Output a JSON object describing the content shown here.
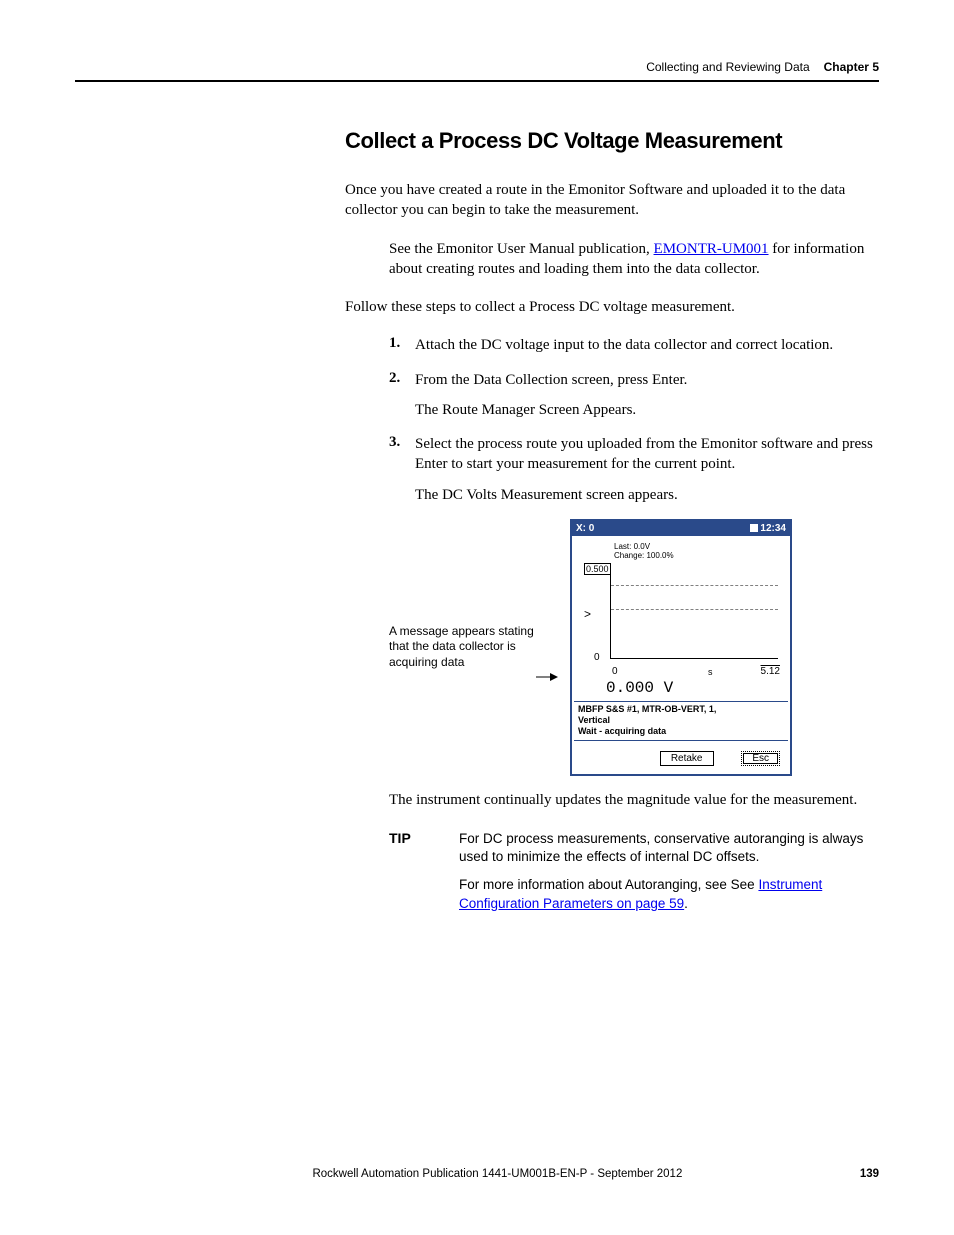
{
  "header": {
    "section": "Collecting and Reviewing Data",
    "chapter": "Chapter 5"
  },
  "title": "Collect a Process DC Voltage Measurement",
  "intro": "Once you have created a route in the Emonitor Software and uploaded it to the data collector you can begin to take the measurement.",
  "ref_pre": "See the Emonitor User Manual publication, ",
  "ref_link": "EMONTR-UM001",
  "ref_post": " for information about creating routes and loading them into the data collector.",
  "follow": "Follow these steps to collect a Process DC voltage measurement.",
  "steps": {
    "s1": "Attach the DC voltage input to the data collector and correct location.",
    "s2a": "From the Data Collection screen, press Enter.",
    "s2b": "The Route Manager Screen Appears.",
    "s3a": "Select the process route you uploaded from the Emonitor software and press Enter to start your measurement for the current point.",
    "s3b": "The DC Volts Measurement screen appears."
  },
  "callout": "A message appears stating that the data collector is acquiring data",
  "device": {
    "title_left": "X:   0",
    "title_right": "12:34",
    "last": "Last: 0.0V",
    "change": "Change: 100.0%",
    "y_top": "0.500",
    "y_mid": ">",
    "y_bot": "0",
    "x_left": "0",
    "x_mid": "s",
    "x_right": "5.12",
    "reading": "0.000 V",
    "status1": "MBFP S&S #1, MTR-OB-VERT, 1,",
    "status2": "Vertical",
    "status3": "Wait - acquiring data",
    "btn_retake": "Retake",
    "btn_esc": "Esc"
  },
  "after_figure": "The instrument continually updates the magnitude value for the measurement.",
  "tip": {
    "label": "TIP",
    "p1": "For DC process measurements, conservative autoranging is always used to minimize the effects of internal DC offsets.",
    "p2_pre": "For more information about Autoranging, see See ",
    "p2_link": "Instrument Configuration Parameters on page 59",
    "p2_post": "."
  },
  "footer": {
    "pub": "Rockwell Automation Publication 1441-UM001B-EN-P - September 2012",
    "page": "139"
  }
}
